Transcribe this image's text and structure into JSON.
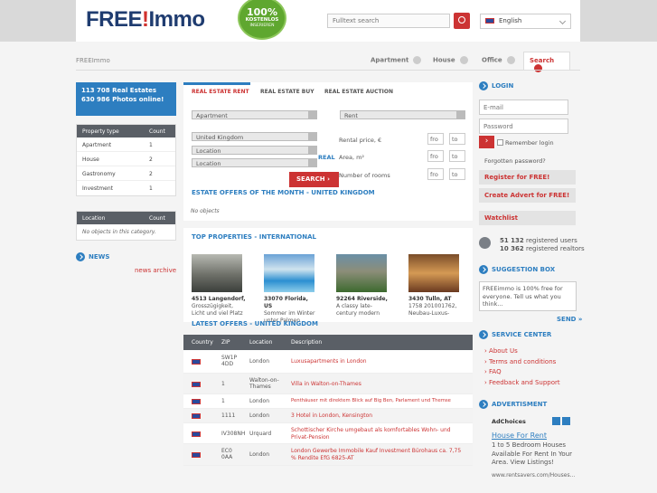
{
  "header": {
    "logo_main": "FREE",
    "logo_mark": "!",
    "logo_tail": "Immo",
    "badge_pct": "100%",
    "badge_l1": "KOSTENLOS",
    "badge_l2": "INSERIEREN",
    "search_placeholder": "Fulltext search",
    "language": "English"
  },
  "breadcrumb": "FREEImmo",
  "nav": {
    "apartment": "Apartment",
    "house": "House",
    "office": "Office",
    "search": "Search"
  },
  "stats": {
    "line1": "113 708 Real Estates",
    "line2": "630 986 Photos online!"
  },
  "property_type": {
    "col1": "Property type",
    "col2": "Count",
    "rows": [
      {
        "name": "Apartment",
        "count": "1"
      },
      {
        "name": "House",
        "count": "2"
      },
      {
        "name": "Gastronomy",
        "count": "2"
      },
      {
        "name": "Investment",
        "count": "1"
      }
    ]
  },
  "location": {
    "col1": "Location",
    "col2": "Count",
    "empty": "No objects in this category."
  },
  "news": {
    "title": "NEWS",
    "archive": "news archive"
  },
  "tabs": {
    "rent": "REAL ESTATE RENT",
    "buy": "REAL ESTATE BUY",
    "auction": "REAL ESTATE AUCTION"
  },
  "form": {
    "type": "Apartment",
    "offer": "Rent",
    "country": "United Kingdom",
    "location1": "Location",
    "location2": "Location",
    "price": "Rental price, €",
    "area": "Area, m²",
    "rooms": "Number of rooms",
    "fro": "fro",
    "to": "to",
    "search": "SEARCH",
    "real": "REAL"
  },
  "offers_month": {
    "title": "ESTATE OFFERS OF THE MONTH - UNITED KINGDOM",
    "empty": "No objects"
  },
  "top": {
    "title": "TOP PROPERTIES - INTERNATIONAL",
    "items": [
      {
        "name": "4513 Langendorf,",
        "desc": "Grosszügigkeit, Licht und viel Platz"
      },
      {
        "name": "33070 Florida, US",
        "desc": "Sommer im Winter unter Palmen"
      },
      {
        "name": "92264 Riverside,",
        "desc": "A classy late-century modern"
      },
      {
        "name": "3430 Tulln, AT",
        "desc": "1758 201001762, Neubau-Luxus-"
      }
    ]
  },
  "latest": {
    "title": "LATEST OFFERS - UNITED KINGDOM",
    "cols": {
      "country": "Country",
      "zip": "ZIP",
      "location": "Location",
      "description": "Description"
    },
    "rows": [
      {
        "zip": "SW1P 4DD",
        "loc": "London",
        "desc": "Luxusapartments in London"
      },
      {
        "zip": "1",
        "loc": "Walton-on-Thames",
        "desc": "Villa in Walton-on-Thames"
      },
      {
        "zip": "1",
        "loc": "London",
        "desc": "Penthäuser mit direktem Blick auf Big Ben, Parlament und Themse"
      },
      {
        "zip": "1111",
        "loc": "London",
        "desc": "3 Hotel in London, Kensington"
      },
      {
        "zip": "IV308NH",
        "loc": "Urquard",
        "desc": "Schottischer Kirche umgebaut als komfortables Wohn- und Privat-Pension"
      },
      {
        "zip": "EC0 0AA",
        "loc": "London",
        "desc": "London Gewerbe Immobile Kauf Investment Bürohaus ca. 7,75 % Rendite EfG 6825-AT"
      }
    ]
  },
  "login": {
    "title": "LOGIN",
    "email": "E-mail",
    "password": "Password",
    "remember": "Remember login",
    "forgot": "Forgotten password?",
    "register": "Register for FREE!",
    "create": "Create Advert for FREE!",
    "watchlist": "Watchlist"
  },
  "users": {
    "count1": "51 132",
    "label1": "registered users",
    "count2": "10 362",
    "label2": "registered realtors"
  },
  "suggestion": {
    "title": "SUGGESTION BOX",
    "text": "FREEimmo is 100% free for everyone. Tell us what you think...",
    "send": "SEND »"
  },
  "service": {
    "title": "SERVICE CENTER",
    "items": [
      "About Us",
      "Terms and conditions",
      "FAQ",
      "Feedback and Support"
    ]
  },
  "ad": {
    "title": "ADVERTISMENT",
    "choices": "AdChoices",
    "headline": "House For Rent",
    "body": "1 to 5 Bedroom Houses Available For Rent In Your Area. View Listings!",
    "url": "www.rentsavers.com/Houses..."
  }
}
